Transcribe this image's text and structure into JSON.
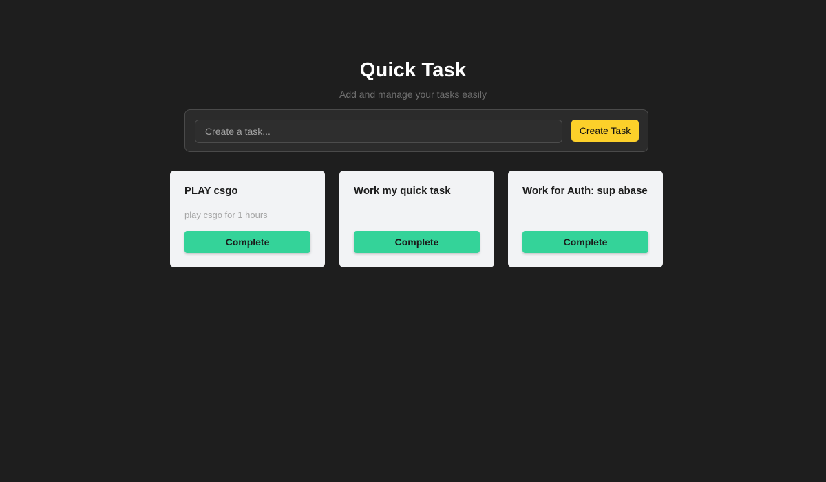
{
  "header": {
    "title": "Quick Task",
    "subtitle": "Add and manage your tasks easily"
  },
  "create": {
    "placeholder": "Create a task...",
    "value": "",
    "button_label": "Create Task"
  },
  "colors": {
    "background": "#1e1e1e",
    "accent_yellow": "#fcd02a",
    "complete_green": "#34d399",
    "card_bg": "#f2f3f5"
  },
  "tasks": [
    {
      "title": "PLAY csgo",
      "description": "play csgo for 1 hours",
      "button_label": "Complete"
    },
    {
      "title": "Work my quick task",
      "description": "",
      "button_label": "Complete"
    },
    {
      "title": "Work for Auth: sup abase",
      "description": "",
      "button_label": "Complete"
    }
  ]
}
